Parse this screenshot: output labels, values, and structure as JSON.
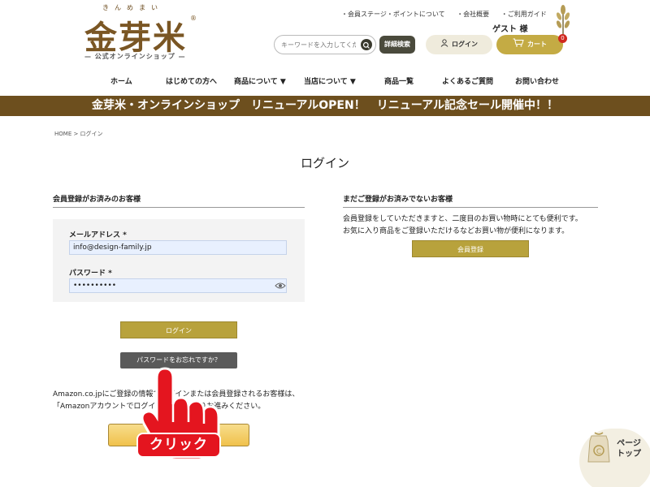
{
  "header": {
    "logo_kana": "きんめまい",
    "logo_text": "金芽米",
    "logo_reg": "®",
    "logo_sub": "— 公式オンラインショップ —",
    "top_links": [
      "・会員ステージ・ポイントについて",
      "・会社概要",
      "・ご利用ガイド"
    ],
    "guest_label": "ゲスト 様",
    "search_placeholder": "キーワードを入力してください",
    "adv_search_label": "詳細検索",
    "login_label": "ログイン",
    "cart_label": "カート",
    "cart_count": "0"
  },
  "nav": {
    "items": [
      "ホーム",
      "はじめての方へ",
      "商品について ▼",
      "当店について ▼",
      "商品一覧",
      "よくあるご質問",
      "お問い合わせ"
    ]
  },
  "banner": {
    "text": "金芽米・オンラインショップ　リニューアルOPEN！　リニューアル記念セール開催中！！"
  },
  "breadcrumb": "HOME > ログイン",
  "page_title": "ログイン",
  "member": {
    "heading": "会員登録がお済みのお客様",
    "email_label": "メールアドレス *",
    "email_value": "info@design-family.jp",
    "password_label": "パスワード *",
    "password_value": "••••••••••",
    "login_button": "ログイン",
    "forgot_button": "パスワードをお忘れですか？",
    "amazon_text": "Amazon.co.jpにご登録の情報でログインまたは会員登録されるお客様は、「Amazonアカウントでログイン」ボタンよりお進みください。"
  },
  "guest": {
    "heading": "まだご登録がお済みでないお客様",
    "desc_1": "会員登録をしていただきますと、二度目のお買い物時にとても便利です。",
    "desc_2": "お気に入り商品をご登録いただけるなどお買い物が便利になります。",
    "register_button": "会員登録"
  },
  "overlay": {
    "click_label": "クリック"
  },
  "page_top": {
    "line1": "ページ",
    "line2": "トップ"
  },
  "colors": {
    "brand_brown": "#6d4f1e",
    "gold": "#b8a23c",
    "cart_gold": "#c4ab44",
    "dark_button": "#5a5a5a",
    "badge_red": "#d0281e",
    "click_red": "#e4151f"
  }
}
